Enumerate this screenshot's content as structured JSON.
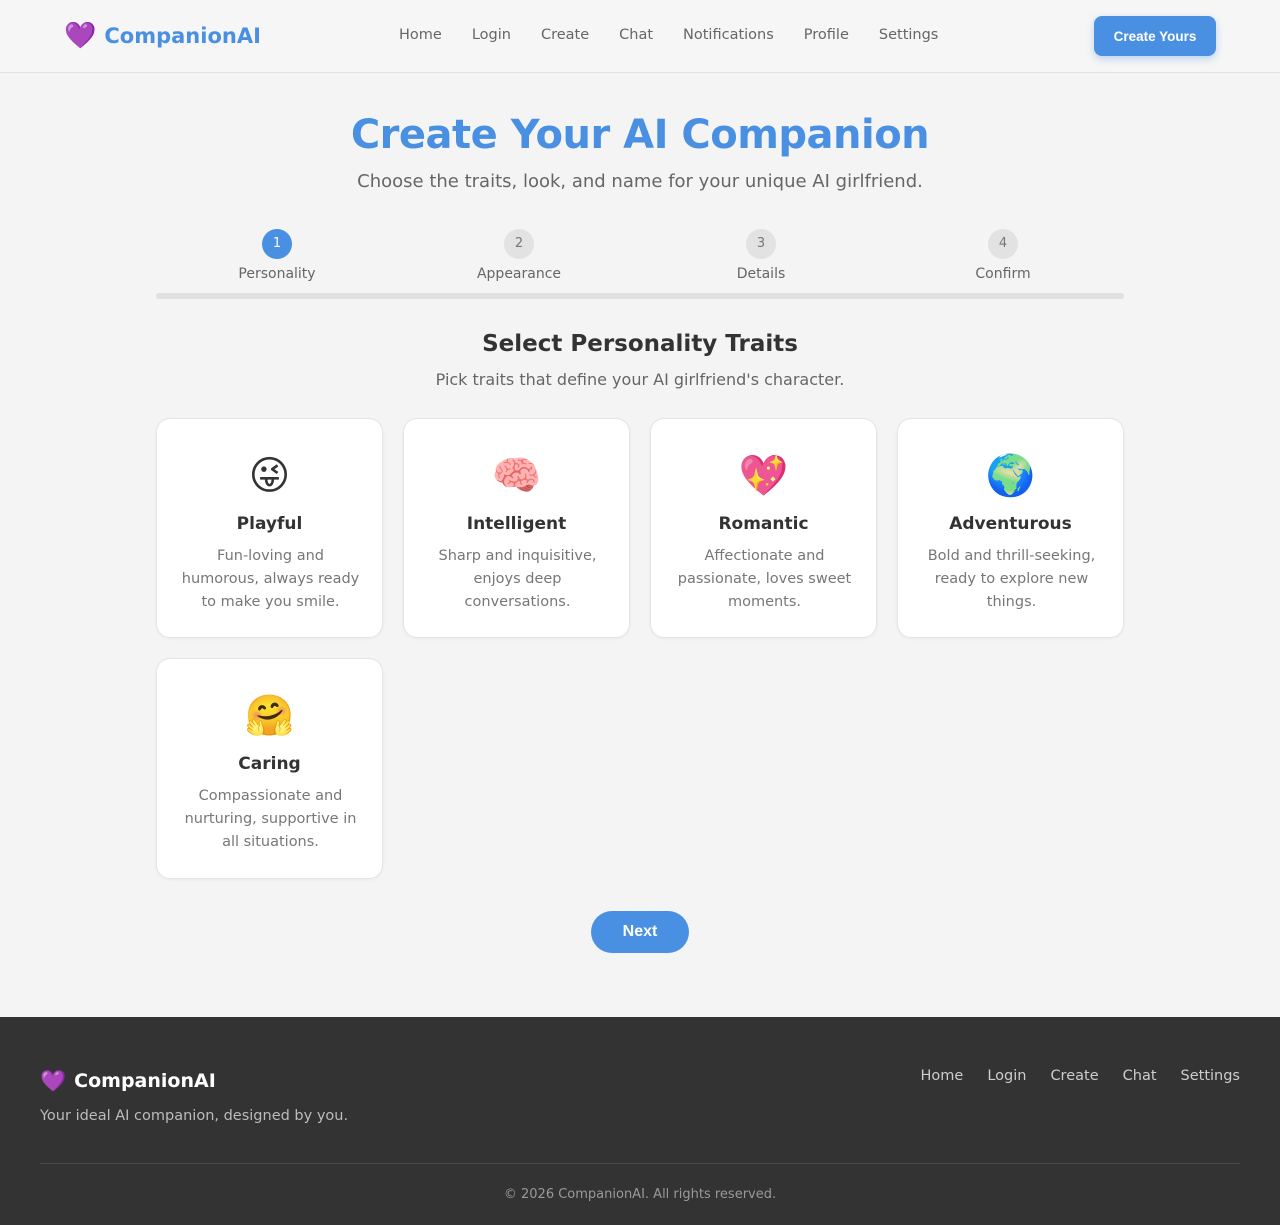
{
  "header": {
    "brand_icon": "💜",
    "brand_name": "CompanionAI",
    "nav": [
      "Home",
      "Login",
      "Create",
      "Chat",
      "Notifications",
      "Profile",
      "Settings"
    ],
    "cta_label": "Create Yours"
  },
  "hero": {
    "title": "Create Your AI Companion",
    "subtitle": "Choose the traits, look, and name for your unique AI girlfriend."
  },
  "steps": [
    {
      "number": "1",
      "label": "Personality",
      "active": true
    },
    {
      "number": "2",
      "label": "Appearance",
      "active": false
    },
    {
      "number": "3",
      "label": "Details",
      "active": false
    },
    {
      "number": "4",
      "label": "Confirm",
      "active": false
    }
  ],
  "progress_fraction": 0,
  "section": {
    "title": "Select Personality Traits",
    "subtitle": "Pick traits that define your AI girlfriend's character."
  },
  "traits": [
    {
      "icon": "😜",
      "icon_name": "playful-face-icon",
      "title": "Playful",
      "description": "Fun-loving and humorous, always ready to make you smile."
    },
    {
      "icon": "🧠",
      "icon_name": "brain-icon",
      "title": "Intelligent",
      "description": "Sharp and inquisitive, enjoys deep conversations."
    },
    {
      "icon": "💖",
      "icon_name": "sparkling-heart-icon",
      "title": "Romantic",
      "description": "Affectionate and passionate, loves sweet moments."
    },
    {
      "icon": "🌍",
      "icon_name": "globe-icon",
      "title": "Adventurous",
      "description": "Bold and thrill-seeking, ready to explore new things."
    },
    {
      "icon": "🤗",
      "icon_name": "hugging-face-icon",
      "title": "Caring",
      "description": "Compassionate and nurturing, supportive in all situations."
    }
  ],
  "next_label": "Next",
  "footer": {
    "brand_icon": "💜",
    "brand_name": "CompanionAI",
    "tagline": "Your ideal AI companion, designed by you.",
    "nav": [
      "Home",
      "Login",
      "Create",
      "Chat",
      "Settings"
    ],
    "copyright": "© 2026 CompanionAI. All rights reserved."
  },
  "colors": {
    "accent": "#4a90e2",
    "background": "#f4f4f4",
    "footer": "#333333"
  }
}
